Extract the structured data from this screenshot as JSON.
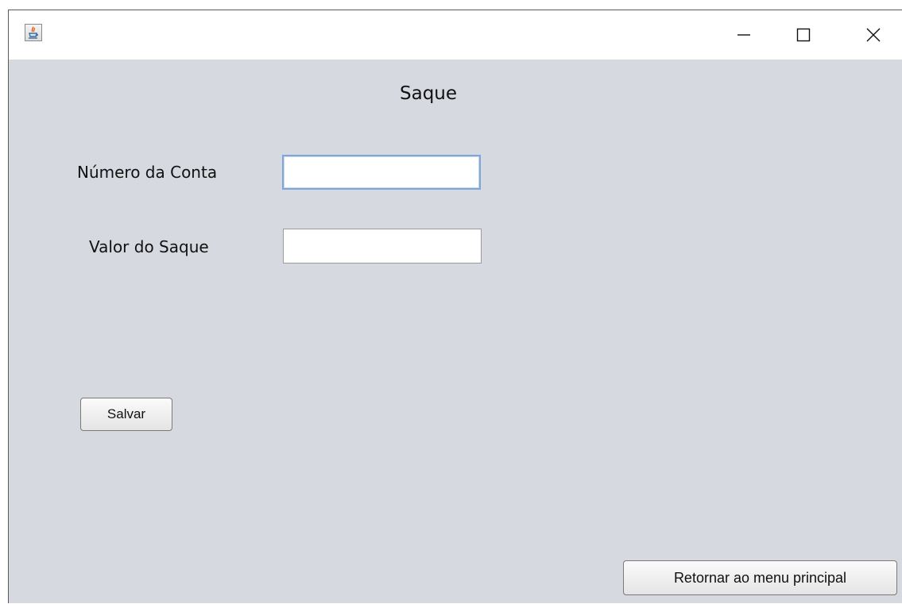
{
  "window": {
    "title": "",
    "icon": "java-cup-icon",
    "controls": {
      "minimize_icon": "minimize-icon",
      "maximize_icon": "maximize-icon",
      "close_icon": "close-icon"
    }
  },
  "form": {
    "title": "Saque",
    "fields": [
      {
        "label": "Número da Conta",
        "value": "",
        "focused": true
      },
      {
        "label": "Valor do Saque",
        "value": "",
        "focused": false
      }
    ],
    "save_label": "Salvar",
    "return_label": "Retornar ao menu principal"
  },
  "colors": {
    "background": "#d6d9e0",
    "titlebar": "#ffffff",
    "focus_border": "#7ea7d6"
  }
}
